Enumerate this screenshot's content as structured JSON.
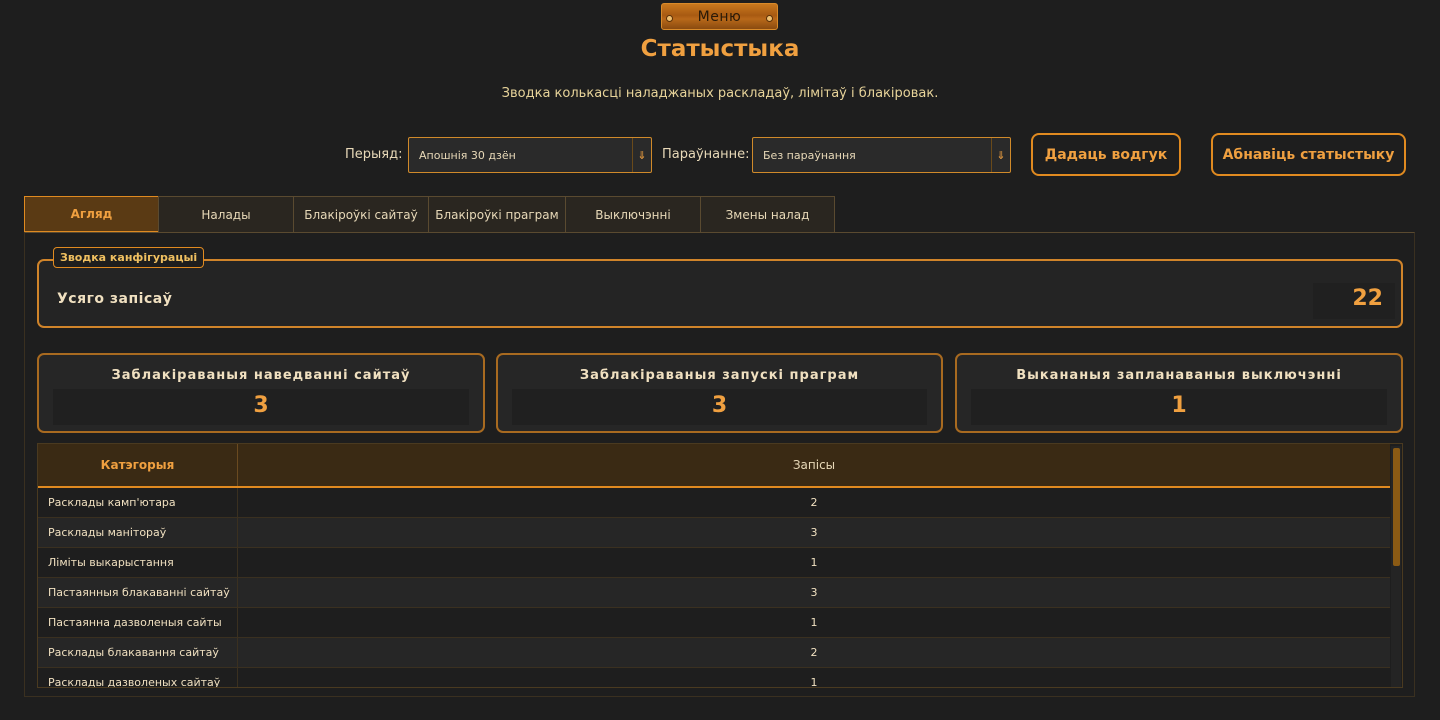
{
  "header": {
    "menu_label": "Меню",
    "title": "Статыстыка",
    "subtitle": "Зводка колькасці наладжаных раскладаў, лімітаў і блакіровак."
  },
  "filters": {
    "period_label": "Перыяд:",
    "period_value": "Апошнія 30 дзён",
    "compare_label": "Параўнанне:",
    "compare_value": "Без параўнання",
    "feedback_button": "Дадаць водгук",
    "refresh_button": "Абнавіць статыстыку"
  },
  "tabs": [
    {
      "label": "Агляд",
      "active": true
    },
    {
      "label": "Налады",
      "active": false
    },
    {
      "label": "Блакіроўкі сайтаў",
      "active": false
    },
    {
      "label": "Блакіроўкі праграм",
      "active": false
    },
    {
      "label": "Выключэнні",
      "active": false
    },
    {
      "label": "Змены налад",
      "active": false
    }
  ],
  "config_summary": {
    "legend": "Зводка канфігурацыі",
    "total_label": "Усяго запісаў",
    "total_value": "22"
  },
  "cards": [
    {
      "title": "Заблакіраваныя наведванні сайтаў",
      "value": "3"
    },
    {
      "title": "Заблакіраваныя запускі праграм",
      "value": "3"
    },
    {
      "title": "Выкананыя запланаваныя выключэнні",
      "value": "1"
    }
  ],
  "table": {
    "columns": [
      "Катэгорыя",
      "Запісы"
    ],
    "rows": [
      {
        "category": "Расклады камп'ютара",
        "count": "2"
      },
      {
        "category": "Расклады маніторaў",
        "count": "3"
      },
      {
        "category": "Ліміты выкарыстання",
        "count": "1"
      },
      {
        "category": "Пастаянныя блакаванні сайтаў",
        "count": "3"
      },
      {
        "category": "Пастаянна дазволеныя сайты",
        "count": "1"
      },
      {
        "category": "Расклады блакавання сайтаў",
        "count": "2"
      },
      {
        "category": "Расклады дазволеных сайтаў",
        "count": "1"
      }
    ]
  },
  "colors": {
    "accent": "#f0a040",
    "border": "#e08a20",
    "background": "#1e1e1e"
  }
}
